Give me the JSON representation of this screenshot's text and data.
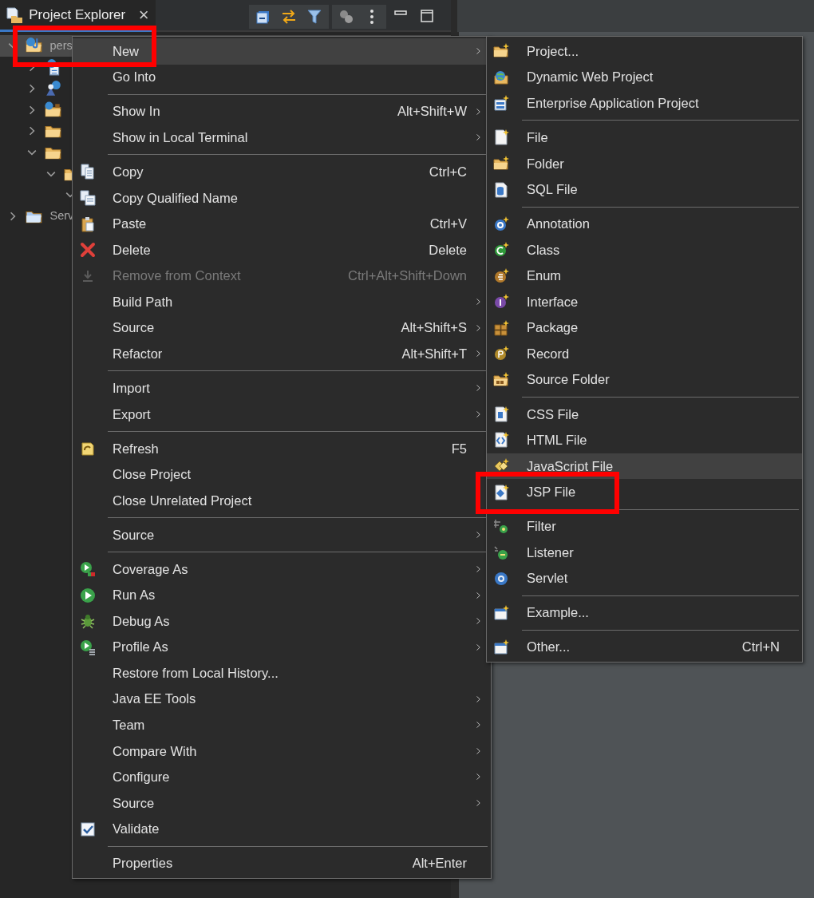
{
  "view": {
    "title": "Project Explorer",
    "close": "×"
  },
  "tree": [
    {
      "label": "pers",
      "expanded": true,
      "selected": true,
      "children": [
        {
          "expanded": false,
          "selected": false
        },
        {
          "expanded": false,
          "selected": false
        },
        {
          "expanded": false,
          "selected": false
        },
        {
          "expanded": false,
          "selected": false
        },
        {
          "expanded": true,
          "selected": false,
          "children": [
            {
              "expanded": true,
              "selected": false,
              "children": [
                {
                  "expanded": true,
                  "selected": false
                }
              ]
            }
          ]
        }
      ]
    },
    {
      "label": "Serv",
      "expanded": false,
      "selected": false
    }
  ],
  "context_menu": [
    {
      "kind": "item",
      "label": "New",
      "submenu": true,
      "hovered": true,
      "marked": true,
      "disabled": false
    },
    {
      "kind": "item",
      "label": "Go Into",
      "submenu": false,
      "hovered": false,
      "marked": false,
      "disabled": false
    },
    {
      "kind": "separator"
    },
    {
      "kind": "item",
      "label": "Show In",
      "shortcut": "Alt+Shift+W",
      "submenu": true,
      "hovered": false,
      "marked": false,
      "disabled": false
    },
    {
      "kind": "item",
      "label": "Show in Local Terminal",
      "submenu": true,
      "hovered": false,
      "marked": false,
      "disabled": false
    },
    {
      "kind": "separator"
    },
    {
      "kind": "item",
      "label": "Copy",
      "shortcut": "Ctrl+C",
      "submenu": false,
      "hovered": false,
      "marked": false,
      "disabled": false
    },
    {
      "kind": "item",
      "label": "Copy Qualified Name",
      "submenu": false,
      "hovered": false,
      "marked": false,
      "disabled": false
    },
    {
      "kind": "item",
      "label": "Paste",
      "shortcut": "Ctrl+V",
      "submenu": false,
      "hovered": false,
      "marked": false,
      "disabled": false
    },
    {
      "kind": "item",
      "label": "Delete",
      "shortcut": "Delete",
      "submenu": false,
      "hovered": false,
      "marked": false,
      "disabled": false
    },
    {
      "kind": "item",
      "label": "Remove from Context",
      "shortcut": "Ctrl+Alt+Shift+Down",
      "submenu": false,
      "hovered": false,
      "marked": false,
      "disabled": true
    },
    {
      "kind": "item",
      "label": "Build Path",
      "submenu": true,
      "hovered": false,
      "marked": false,
      "disabled": false
    },
    {
      "kind": "item",
      "label": "Source",
      "shortcut": "Alt+Shift+S",
      "submenu": true,
      "hovered": false,
      "marked": false,
      "disabled": false
    },
    {
      "kind": "item",
      "label": "Refactor",
      "shortcut": "Alt+Shift+T",
      "submenu": true,
      "hovered": false,
      "marked": false,
      "disabled": false
    },
    {
      "kind": "separator"
    },
    {
      "kind": "item",
      "label": "Import",
      "submenu": true,
      "hovered": false,
      "marked": false,
      "disabled": false
    },
    {
      "kind": "item",
      "label": "Export",
      "submenu": true,
      "hovered": false,
      "marked": false,
      "disabled": false
    },
    {
      "kind": "separator"
    },
    {
      "kind": "item",
      "label": "Refresh",
      "shortcut": "F5",
      "submenu": false,
      "hovered": false,
      "marked": false,
      "disabled": false
    },
    {
      "kind": "item",
      "label": "Close Project",
      "hovered": false,
      "marked": false,
      "disabled": false
    },
    {
      "kind": "item",
      "label": "Close Unrelated Project",
      "hovered": false,
      "marked": false,
      "disabled": false
    },
    {
      "kind": "separator"
    },
    {
      "kind": "item",
      "label": "Source",
      "submenu": true,
      "hovered": false,
      "marked": false,
      "disabled": false
    },
    {
      "kind": "separator"
    },
    {
      "kind": "item",
      "label": "Coverage As",
      "submenu": true,
      "hovered": false,
      "marked": false,
      "disabled": false
    },
    {
      "kind": "item",
      "label": "Run As",
      "submenu": true,
      "hovered": false,
      "marked": false,
      "disabled": false
    },
    {
      "kind": "item",
      "label": "Debug As",
      "submenu": true,
      "hovered": false,
      "marked": false,
      "disabled": false
    },
    {
      "kind": "item",
      "label": "Profile As",
      "submenu": true,
      "hovered": false,
      "marked": false,
      "disabled": false
    },
    {
      "kind": "item",
      "label": "Restore from Local History...",
      "submenu": false,
      "hovered": false,
      "marked": false,
      "disabled": false
    },
    {
      "kind": "item",
      "label": "Java EE Tools",
      "submenu": true,
      "hovered": false,
      "marked": false,
      "disabled": false
    },
    {
      "kind": "item",
      "label": "Team",
      "submenu": true,
      "hovered": false,
      "marked": false,
      "disabled": false
    },
    {
      "kind": "item",
      "label": "Compare With",
      "submenu": true,
      "hovered": false,
      "marked": false,
      "disabled": false
    },
    {
      "kind": "item",
      "label": "Configure",
      "submenu": true,
      "hovered": false,
      "marked": false,
      "disabled": false
    },
    {
      "kind": "item",
      "label": "Source",
      "submenu": true,
      "hovered": false,
      "marked": false,
      "disabled": false
    },
    {
      "kind": "item",
      "label": "Validate",
      "submenu": false,
      "hovered": false,
      "marked": false,
      "disabled": false
    },
    {
      "kind": "separator"
    },
    {
      "kind": "item",
      "label": "Properties",
      "shortcut": "Alt+Enter",
      "submenu": false,
      "hovered": false,
      "marked": false,
      "disabled": false
    }
  ],
  "new_submenu": [
    {
      "kind": "item",
      "label": "Project...",
      "hovered": false,
      "marked": false
    },
    {
      "kind": "item",
      "label": "Dynamic Web Project",
      "hovered": false,
      "marked": false
    },
    {
      "kind": "item",
      "label": "Enterprise Application Project",
      "hovered": false,
      "marked": false
    },
    {
      "kind": "separator"
    },
    {
      "kind": "item",
      "label": "File",
      "hovered": false,
      "marked": false
    },
    {
      "kind": "item",
      "label": "Folder",
      "hovered": false,
      "marked": false
    },
    {
      "kind": "item",
      "label": "SQL File",
      "hovered": false,
      "marked": false
    },
    {
      "kind": "separator"
    },
    {
      "kind": "item",
      "label": "Annotation",
      "hovered": false,
      "marked": false
    },
    {
      "kind": "item",
      "label": "Class",
      "hovered": false,
      "marked": false
    },
    {
      "kind": "item",
      "label": "Enum",
      "hovered": false,
      "marked": false
    },
    {
      "kind": "item",
      "label": "Interface",
      "hovered": false,
      "marked": false
    },
    {
      "kind": "item",
      "label": "Package",
      "hovered": false,
      "marked": false
    },
    {
      "kind": "item",
      "label": "Record",
      "hovered": false,
      "marked": false
    },
    {
      "kind": "item",
      "label": "Source Folder",
      "hovered": false,
      "marked": false
    },
    {
      "kind": "separator"
    },
    {
      "kind": "item",
      "label": "CSS File",
      "hovered": false,
      "marked": false
    },
    {
      "kind": "item",
      "label": "HTML File",
      "hovered": false,
      "marked": false
    },
    {
      "kind": "item",
      "label": "JavaScript File",
      "hovered": true,
      "marked": false
    },
    {
      "kind": "item",
      "label": "JSP File",
      "hovered": false,
      "marked": true
    },
    {
      "kind": "separator"
    },
    {
      "kind": "item",
      "label": "Filter",
      "hovered": false,
      "marked": false
    },
    {
      "kind": "item",
      "label": "Listener",
      "hovered": false,
      "marked": false
    },
    {
      "kind": "item",
      "label": "Servlet",
      "hovered": false,
      "marked": false
    },
    {
      "kind": "separator"
    },
    {
      "kind": "item",
      "label": "Example...",
      "hovered": false,
      "marked": false
    },
    {
      "kind": "separator"
    },
    {
      "kind": "item",
      "label": "Other...",
      "shortcut": "Ctrl+N",
      "hovered": false,
      "marked": false
    }
  ]
}
